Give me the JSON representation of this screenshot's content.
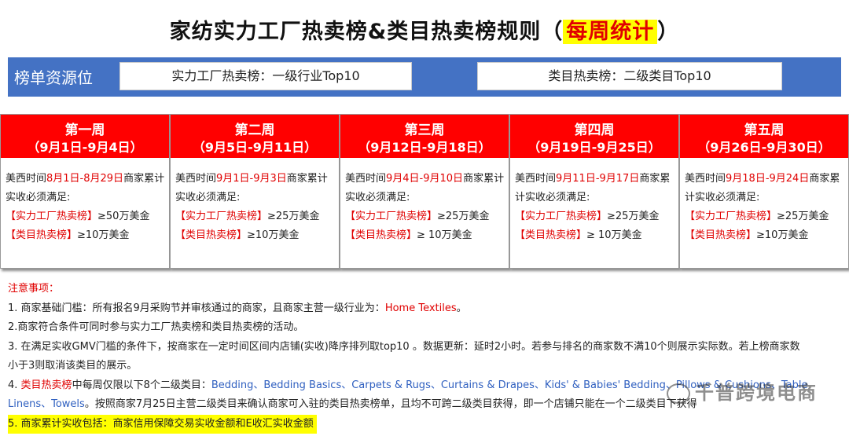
{
  "title": {
    "main": "家纺实力工厂热卖榜&类目热卖榜规则（",
    "highlight": "每周统计",
    "end": "）"
  },
  "resource": {
    "label": "榜单资源位",
    "factory": "实力工厂热卖榜：一级行业Top10",
    "category": "类目热卖榜：二级类目Top10"
  },
  "weeks": [
    {
      "name": "第一周",
      "range": "（9月1日-9月4日）",
      "time_prefix": "美西时间",
      "time_range": "8月1日-8月29日",
      "time_suffix": "商家累计实收必须满足:",
      "factory_label": "【实力工厂热卖榜】",
      "factory_value": "≥50万美金",
      "category_label": "【类目热卖榜】",
      "category_value": "≥10万美金"
    },
    {
      "name": "第二周",
      "range": "（9月5日-9月11日）",
      "time_prefix": "美西时间",
      "time_range": "9月1日-9月3日",
      "time_suffix": "商家累计实收必须满足:",
      "factory_label": "【实力工厂热卖榜】",
      "factory_value": "≥25万美金",
      "category_label": "【类目热卖榜】",
      "category_value": "≥10万美金"
    },
    {
      "name": "第三周",
      "range": "（9月12日-9月18日）",
      "time_prefix": "美西时间",
      "time_range": "9月4日-9月10日",
      "time_suffix": "商家累计实收必须满足:",
      "factory_label": "【实力工厂热卖榜】",
      "factory_value": "≥25万美金",
      "category_label": "【类目热卖榜】",
      "category_value": "≥ 10万美金"
    },
    {
      "name": "第四周",
      "range": "（9月19日-9月25日）",
      "time_prefix": "美西时间",
      "time_range": "9月11日-9月17日",
      "time_suffix": "商家累计实收必须满足:",
      "factory_label": "【实力工厂热卖榜】",
      "factory_value": "≥25万美金",
      "category_label": "【类目热卖榜】",
      "category_value": "≥ 10万美金"
    },
    {
      "name": "第五周",
      "range": "（9月26日-9月30日）",
      "time_prefix": "美西时间",
      "time_range": "9月18日-9月24日",
      "time_suffix": "商家累计实收必须满足:",
      "factory_label": "【实力工厂热卖榜】",
      "factory_value": "≥25万美金",
      "category_label": "【类目热卖榜】",
      "category_value": "≥10万美金"
    }
  ],
  "notes": {
    "heading": "注意事项：",
    "n1_prefix": "1. 商家基础门槛：所有报名9月采购节并审核通过的商家，且商家主营一级行业为：",
    "n1_highlight": "Home Textiles",
    "n1_suffix": "。",
    "n2": "2.商家符合条件可同时参与实力工厂热卖榜和类目热卖榜的活动。",
    "n3a": "3. 在满足实收GMV门槛的条件下，按商家在一定时间区间内店铺(实收)降序排列取top10 。数据更新：延时2小时。若参与排名的商家数不满10个则展示实际数。若上榜商家数",
    "n3b": "小于3则取消该类目的展示。",
    "n4_prefix": "4. ",
    "n4_red": "类目热卖榜",
    "n4_mid": "中每周仅限以下8个二级类目：",
    "n4_list": "Bedding、Bedding Basics、Carpets & Rugs、Curtains & Drapes、Kids' & Babies' Bedding、Pillows & Cushions、Table",
    "n4b_list": "Linens、Towels",
    "n4b_text": "。按照商家7月25日主营二级类目来确认商家可入驻的类目热卖榜单，且均不可跨二级类目获得，即一个店铺只能在一个二级类目下获得",
    "n5": "5. 商家累计实收包括：商家信用保障交易实收金额和E收汇实收金额"
  },
  "watermark": "千普跨境电商"
}
